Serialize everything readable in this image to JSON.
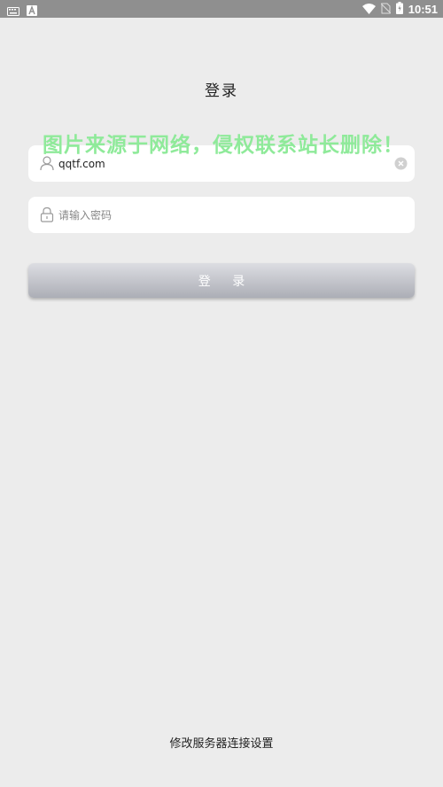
{
  "status_bar": {
    "time": "10:51",
    "icons": [
      "keyboard-icon",
      "text-a-icon",
      "wifi-icon",
      "no-sim-icon",
      "battery-icon"
    ]
  },
  "page": {
    "title": "登录"
  },
  "watermark": {
    "text": "图片来源于网络，侵权联系站长删除！"
  },
  "login_form": {
    "username": {
      "value": "qqtf.com",
      "icon": "user-icon"
    },
    "password": {
      "placeholder": "请输入密码",
      "icon": "lock-icon"
    },
    "submit_label": "登 录"
  },
  "footer": {
    "server_settings_link": "修改服务器连接设置"
  },
  "colors": {
    "background": "#ececec",
    "status_bar": "#8f8f8f",
    "watermark": "#8fea9a",
    "button_top": "#dcdde2",
    "button_bottom": "#acaeb6"
  }
}
